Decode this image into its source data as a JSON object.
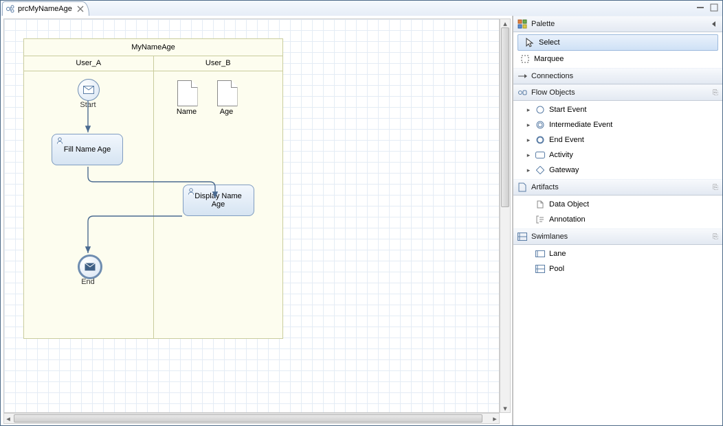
{
  "tab": {
    "title": "prcMyNameAge"
  },
  "diagram": {
    "pool": "MyNameAge",
    "lanes": [
      "User_A",
      "User_B"
    ],
    "start": {
      "label": "Start"
    },
    "end": {
      "label": "End"
    },
    "task1": {
      "label": "Fill Name Age"
    },
    "task2": {
      "label": "Display Name Age"
    },
    "data1": {
      "label": "Name"
    },
    "data2": {
      "label": "Age"
    }
  },
  "palette": {
    "title": "Palette",
    "select": "Select",
    "marquee": "Marquee",
    "groups": {
      "connections": "Connections",
      "flow": "Flow Objects",
      "artifacts": "Artifacts",
      "swimlanes": "Swimlanes"
    },
    "flow_items": {
      "start": "Start Event",
      "intermediate": "Intermediate Event",
      "end": "End Event",
      "activity": "Activity",
      "gateway": "Gateway"
    },
    "artifact_items": {
      "dataobj": "Data Object",
      "annotation": "Annotation"
    },
    "swimlane_items": {
      "lane": "Lane",
      "pool": "Pool"
    }
  }
}
